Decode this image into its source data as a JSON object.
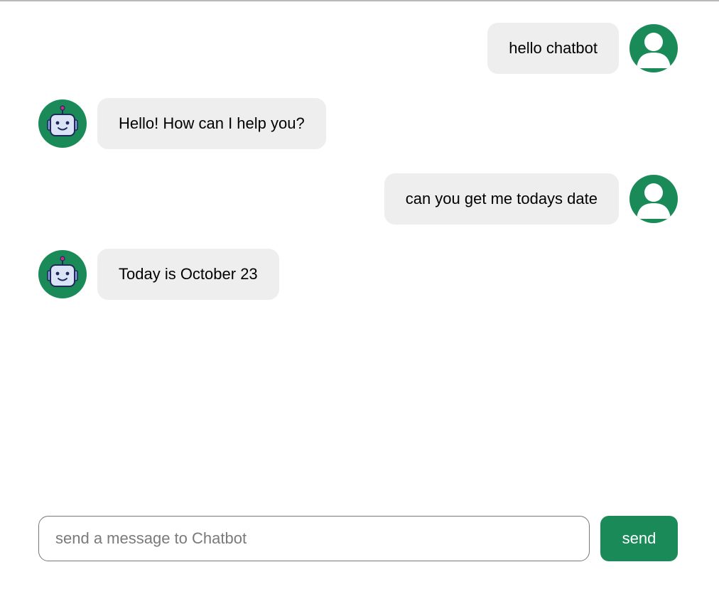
{
  "colors": {
    "accent": "#1a8a59",
    "bubble_bg": "#eeeeee",
    "robot_face": "#dbe3f7",
    "robot_outline": "#1f2a5a",
    "robot_antenna_tip": "#c2338a"
  },
  "messages": [
    {
      "sender": "user",
      "text": "hello chatbot",
      "avatar_icon": "user-avatar-icon"
    },
    {
      "sender": "bot",
      "text": "Hello! How can I help you?",
      "avatar_icon": "robot-avatar-icon"
    },
    {
      "sender": "user",
      "text": "can you get me todays date",
      "avatar_icon": "user-avatar-icon"
    },
    {
      "sender": "bot",
      "text": "Today is October 23",
      "avatar_icon": "robot-avatar-icon"
    }
  ],
  "composer": {
    "placeholder": "send a message to Chatbot",
    "value": "",
    "send_label": "send"
  }
}
